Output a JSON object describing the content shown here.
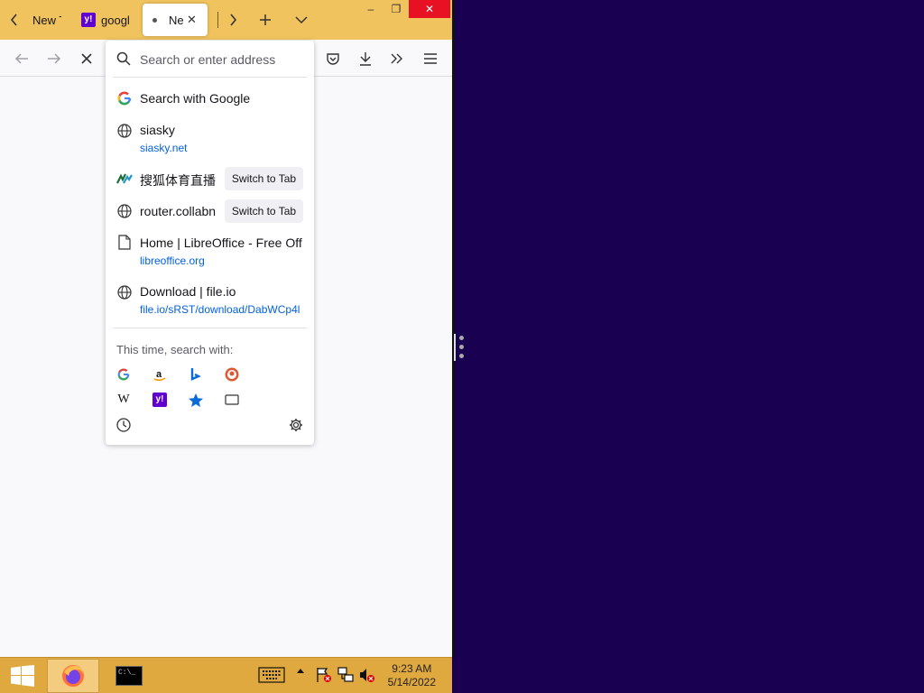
{
  "tabs": [
    {
      "title": "New T",
      "icon": "blank"
    },
    {
      "title": "googl",
      "icon": "yahoo-icon"
    },
    {
      "title": "Ne",
      "icon": "loading-dot",
      "active": true
    }
  ],
  "window_controls": {
    "minimize": "–",
    "restore": "❐",
    "close": "✕"
  },
  "url_bar": {
    "placeholder": "Search or enter address"
  },
  "results": [
    {
      "title": "Search with Google",
      "url": "",
      "icon": "google-icon"
    },
    {
      "title": "siasky",
      "url": "siasky.net",
      "icon": "globe-icon"
    },
    {
      "title": "搜狐体育直播",
      "url": "",
      "icon": "sohu-icon",
      "action": "Switch to Tab"
    },
    {
      "title": "router.collabn",
      "url": "",
      "icon": "globe-icon",
      "action": "Switch to Tab"
    },
    {
      "title": "Home | LibreOffice - Free Offi",
      "url": "libreoffice.org",
      "icon": "page-icon"
    },
    {
      "title": "Download | file.io",
      "url": "file.io/sRST/download/DabWCp4l",
      "icon": "globe-icon"
    }
  ],
  "search_with": {
    "label": "This time, search with:",
    "engines": [
      "google-icon",
      "amazon-icon",
      "bing-icon",
      "duckduckgo-icon",
      "wikipedia-icon",
      "yahoo-icon",
      "bookmarks-icon",
      "tabs-icon",
      "history-icon"
    ]
  },
  "taskbar": {
    "time": "9:23 AM",
    "date": "5/14/2022",
    "apps": [
      "firefox-icon",
      "cmd-icon"
    ],
    "cmd_label": "C:\\_"
  },
  "colors": {
    "tabbar": "#f0c35e",
    "taskbar": "#e0a93f",
    "desktop": "#1a0050",
    "link": "#0060df"
  }
}
